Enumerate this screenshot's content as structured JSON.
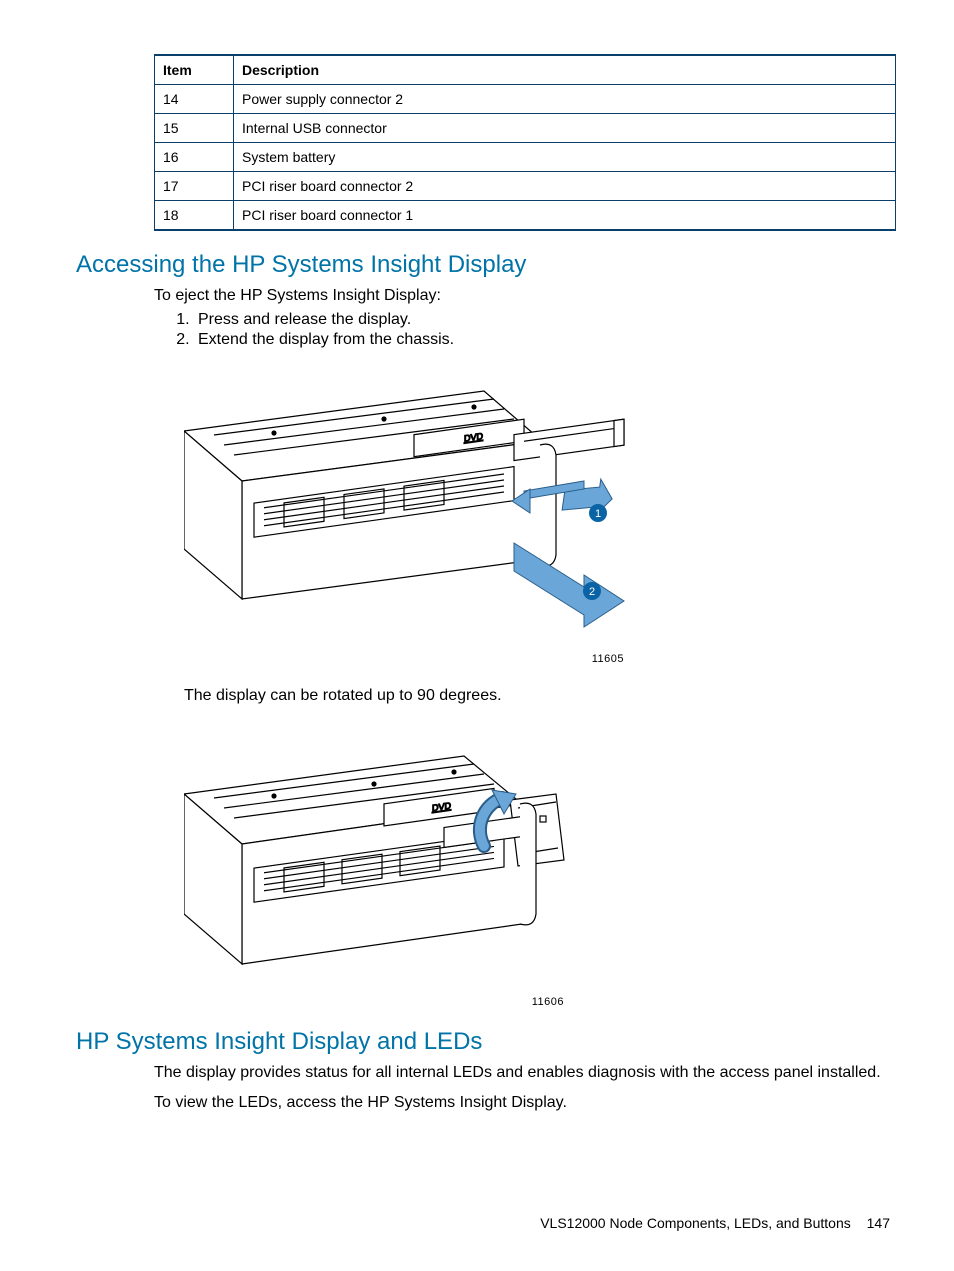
{
  "table": {
    "headers": {
      "item": "Item",
      "desc": "Description"
    },
    "rows": [
      {
        "item": "14",
        "desc": "Power supply connector 2"
      },
      {
        "item": "15",
        "desc": "Internal USB connector"
      },
      {
        "item": "16",
        "desc": "System battery"
      },
      {
        "item": "17",
        "desc": "PCI riser board connector 2"
      },
      {
        "item": "18",
        "desc": "PCI riser board connector 1"
      }
    ]
  },
  "section1": {
    "heading": "Accessing the HP Systems Insight Display",
    "intro": "To eject the HP Systems Insight Display:",
    "steps": [
      "Press and release the display.",
      "Extend the display from the chassis."
    ],
    "fig1_id": "11605",
    "rotate_note": "The display can be rotated up to 90 degrees.",
    "fig2_id": "11606"
  },
  "section2": {
    "heading": "HP Systems Insight Display and LEDs",
    "p1": "The display provides status for all internal LEDs and enables diagnosis with the access panel installed.",
    "p2": "To view the LEDs, access the HP Systems Insight Display."
  },
  "footer": {
    "title": "VLS12000 Node Components, LEDs, and Buttons",
    "page": "147"
  }
}
